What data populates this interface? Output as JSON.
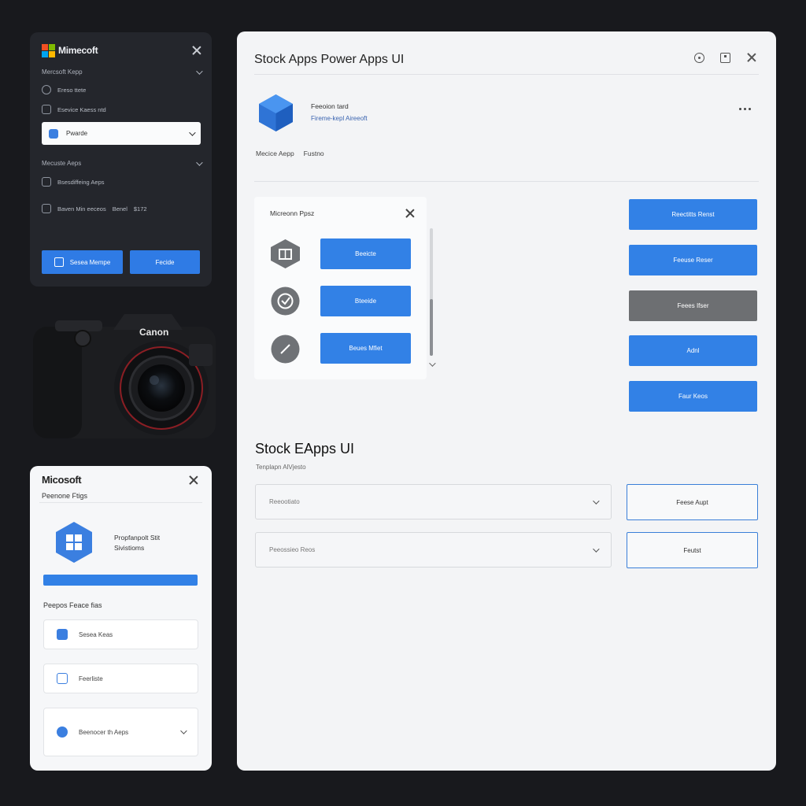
{
  "colors": {
    "accent": "#3281e6",
    "gray_button": "#6d6f72",
    "dark_panel": "#24262c"
  },
  "dark_panel": {
    "brand": "Mimecoft",
    "section1": "Mercsoft Kepp",
    "row1": "Ereso ttete",
    "row2": "Esevice Kaess ntd",
    "select_value": "Pwarde",
    "section2": "Mecuste Aeps",
    "row3": "Bsesdiffeing Aeps",
    "row4": {
      "label": "Baven Min eeceos",
      "value1": "Benel",
      "value2": "$172"
    },
    "button1": "Sesea Mempe",
    "button2": "Fecide"
  },
  "camera": {
    "brand_text": "Canon"
  },
  "light_card": {
    "brand": "Micosoft",
    "subtitle": "Peenone Ftigs",
    "title_line1": "Propfanpolt Stit",
    "title_line2": "Sivistioms",
    "label": "Peepos Feace fias",
    "items": [
      "Sesea Keas",
      "Feerliste",
      "Beenocer th Aeps"
    ]
  },
  "main": {
    "title": "Stock Apps Power Apps UI",
    "app_name": "Feeoion tard",
    "app_sub": "Fireme-kepl Aireeoft",
    "meta": [
      "Mecice Aepp",
      "Fustno"
    ],
    "dialog": {
      "title": "Micreonn Ppsz",
      "buttons": [
        "Beeicte",
        "Bteeide",
        "Beues Mfiet"
      ]
    },
    "side_buttons": [
      "Reectitts Renst",
      "Feeuse Reser",
      "Feees Ifser",
      "Adnl",
      "Faur Keos"
    ],
    "section_title": "Stock EApps UI",
    "section_sub": "Tenplapn AlVjesto",
    "selects": [
      "Reeootiato",
      "Peeossieo Reos"
    ],
    "outline_buttons": [
      "Feese Aupt",
      "Feutst"
    ]
  }
}
